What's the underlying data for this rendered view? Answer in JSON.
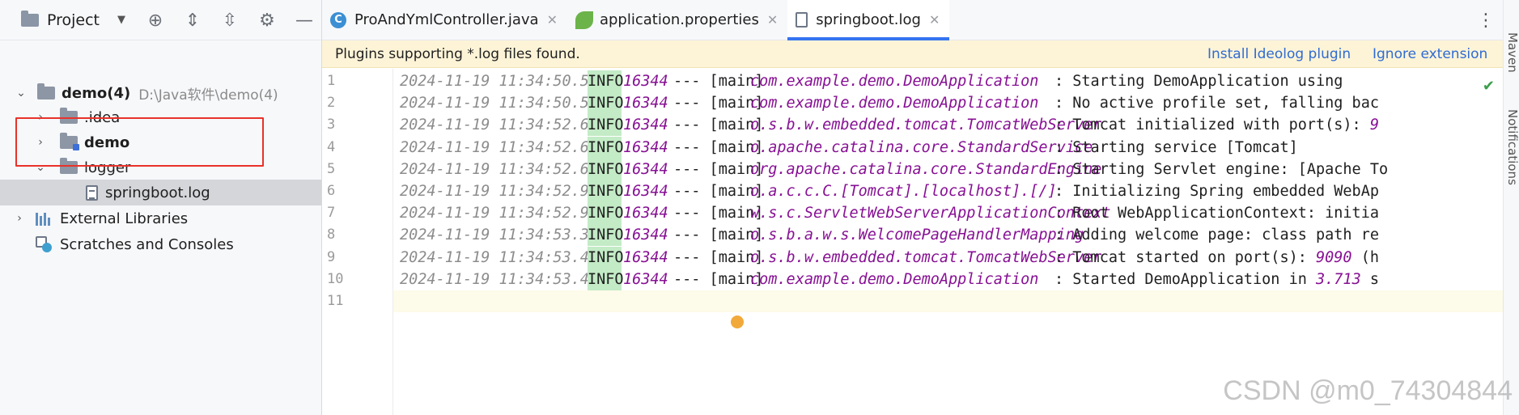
{
  "project_panel": {
    "title": "Project",
    "tree": [
      {
        "label": "demo(4)",
        "path": "D:\\Java软件\\demo(4)"
      },
      {
        "label": ".idea"
      },
      {
        "label": "demo"
      },
      {
        "label": "logger"
      },
      {
        "label": "springboot.log"
      },
      {
        "label": "External Libraries"
      },
      {
        "label": "Scratches and Consoles"
      }
    ]
  },
  "tabs": [
    {
      "label": "ProAndYmlController.java",
      "icon": "java-class-icon"
    },
    {
      "label": "application.properties",
      "icon": "spring-leaf-icon"
    },
    {
      "label": "springboot.log",
      "icon": "log-file-icon",
      "active": true
    }
  ],
  "banner": {
    "message": "Plugins supporting *.log files found.",
    "install_link": "Install Ideolog plugin",
    "ignore_link": "Ignore extension"
  },
  "log": {
    "line_numbers": [
      "1",
      "2",
      "3",
      "4",
      "5",
      "6",
      "7",
      "8",
      "9",
      "10",
      "11"
    ],
    "lines": [
      {
        "ts": "2024-11-19 11:34:50.503",
        "level": "INFO",
        "pid": "16344",
        "thread": "--- [main]",
        "cls": "com.example.demo.DemoApplication",
        "msg": ": Starting DemoApplication using",
        "num": ""
      },
      {
        "ts": "2024-11-19 11:34:50.513",
        "level": "INFO",
        "pid": "16344",
        "thread": "--- [main]",
        "cls": "com.example.demo.DemoApplication",
        "msg": ": No active profile set, falling bac",
        "num": ""
      },
      {
        "ts": "2024-11-19 11:34:52.663",
        "level": "INFO",
        "pid": "16344",
        "thread": "--- [main]",
        "cls": "o.s.b.w.embedded.tomcat.TomcatWebServer",
        "msg": ": Tomcat initialized with port(s): ",
        "num": "9"
      },
      {
        "ts": "2024-11-19 11:34:52.673",
        "level": "INFO",
        "pid": "16344",
        "thread": "--- [main]",
        "cls": "o.apache.catalina.core.StandardService",
        "msg": ": Starting service [Tomcat]",
        "num": ""
      },
      {
        "ts": "2024-11-19 11:34:52.673",
        "level": "INFO",
        "pid": "16344",
        "thread": "--- [main]",
        "cls": "org.apache.catalina.core.StandardEngine",
        "msg": ": Starting Servlet engine: [Apache To",
        "num": ""
      },
      {
        "ts": "2024-11-19 11:34:52.973",
        "level": "INFO",
        "pid": "16344",
        "thread": "--- [main]",
        "cls": "o.a.c.c.C.[Tomcat].[localhost].[/]",
        "msg": ": Initializing Spring embedded WebAp",
        "num": ""
      },
      {
        "ts": "2024-11-19 11:34:52.973",
        "level": "INFO",
        "pid": "16344",
        "thread": "--- [main]",
        "cls": "w.s.c.ServletWebServerApplicationContext",
        "msg": ": Root WebApplicationContext: initia",
        "num": ""
      },
      {
        "ts": "2024-11-19 11:34:53.343",
        "level": "INFO",
        "pid": "16344",
        "thread": "--- [main]",
        "cls": "o.s.b.a.w.s.WelcomePageHandlerMapping",
        "msg": ": Adding welcome page: class path re",
        "num": ""
      },
      {
        "ts": "2024-11-19 11:34:53.484",
        "level": "INFO",
        "pid": "16344",
        "thread": "--- [main]",
        "cls": "o.s.b.w.embedded.tomcat.TomcatWebServer",
        "msg": ": Tomcat started on port(s): ",
        "num": "9090",
        "tail": " (h"
      },
      {
        "ts": "2024-11-19 11:34:53.494",
        "level": "INFO",
        "pid": "16344",
        "thread": "--- [main]",
        "cls": "com.example.demo.DemoApplication",
        "msg": ": Started DemoApplication in ",
        "num": "3.713",
        "tail": " s"
      }
    ]
  },
  "side_labels": {
    "maven": "Maven",
    "notifications": "Notifications"
  },
  "watermark": "CSDN @m0_74304844",
  "colors": {
    "accent": "#3574f0",
    "banner_bg": "#fdf4d7",
    "info_bg": "#c3ebc6",
    "purple": "#871094",
    "highlight_box": "#e8322a"
  }
}
